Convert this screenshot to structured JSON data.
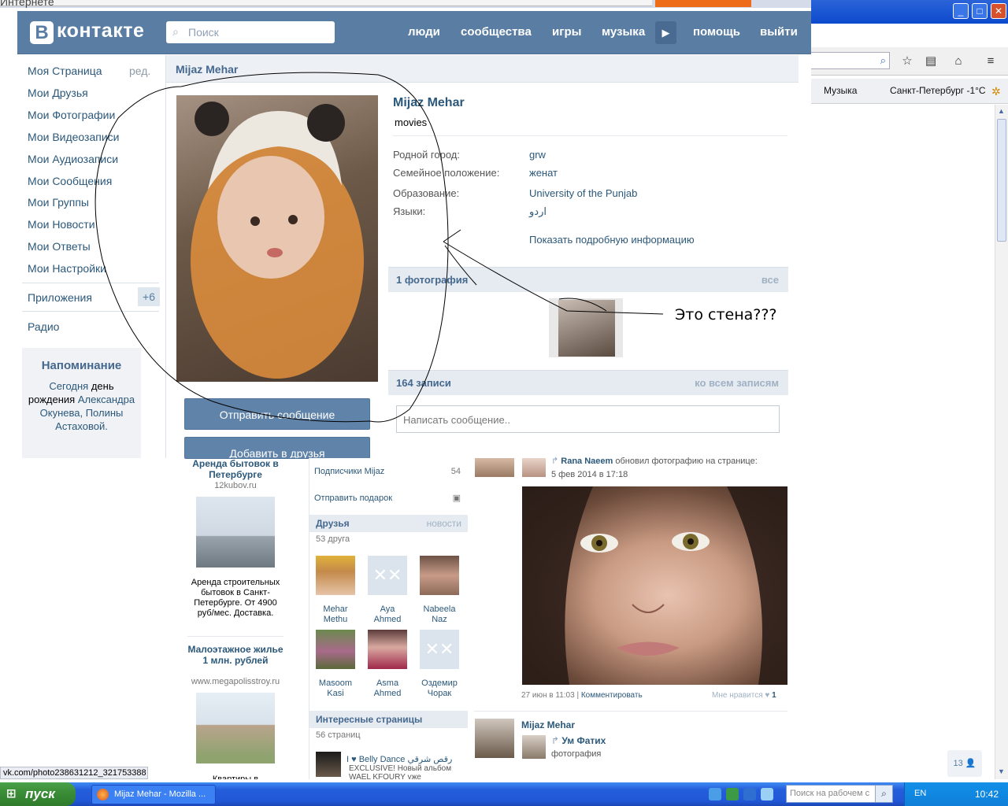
{
  "browser": {
    "title_fragment": "Интернете",
    "win_minimize": "_",
    "win_maximize": "□",
    "win_close": "✕",
    "bookmarks": [
      "Музыка",
      "Санкт-Петербург -1°C"
    ],
    "status_url": "vk.com/photo238631212_321753388"
  },
  "header": {
    "logo_letter": "В",
    "logo_text": "контакте",
    "search_placeholder": "Поиск",
    "nav": [
      "люди",
      "сообщества",
      "игры",
      "музыка",
      "помощь",
      "выйти"
    ]
  },
  "left_menu": {
    "edit": "ред.",
    "items": [
      "Моя Страница",
      "Мои Друзья",
      "Мои Фотографии",
      "Мои Видеозаписи",
      "Мои Аудиозаписи",
      "Мои Сообщения",
      "Мои Группы",
      "Мои Новости",
      "Мои Ответы",
      "Мои Настройки"
    ],
    "apps": "Приложения",
    "apps_badge": "+6",
    "radio": "Радио"
  },
  "reminder": {
    "title": "Напоминание",
    "line1": "Сегодня",
    "line2": "день рождения",
    "names": "Александра Окунева, Полины Астаховой."
  },
  "profile": {
    "name_bar": "Mijaz Mehar",
    "name": "Mijaz Mehar",
    "status": "movies",
    "fields": [
      {
        "label": "Родной город:",
        "value": "grw"
      },
      {
        "label": "Семейное положение:",
        "value": "женат"
      },
      {
        "label": "Образование:",
        "value": "University of the Punjab"
      },
      {
        "label": "Языки:",
        "value": "اردو"
      }
    ],
    "show_more": "Показать подробную информацию",
    "send_message": "Отправить сообщение",
    "add_friend": "Добавить в друзья",
    "photos_title": "1 фотография",
    "photos_all": "все",
    "wall_title": "164 записи",
    "wall_all": "ко всем записям",
    "wall_placeholder": "Написать сообщение.."
  },
  "annotation": "Это стена???",
  "ads": [
    {
      "title": "Аренда бытовок в Петербурге",
      "url": "12kubov.ru",
      "text": "Аренда строительных бытовок в Санкт-Петербурге. От 4900 руб/мес. Доставка."
    },
    {
      "title": "Малоэтажное жилье 1 млн. рублей",
      "url": "www.megapolisstroy.ru",
      "text": "Квартиры в"
    }
  ],
  "mid": {
    "subscribers": "Подписчики Mijaz",
    "subscribers_count": "54",
    "gift": "Отправить подарок",
    "friends_title": "Друзья",
    "friends_news": "новости",
    "friends_count": "53 друга",
    "friends": [
      {
        "first": "Mehar",
        "last": "Methu"
      },
      {
        "first": "Aya",
        "last": "Ahmed"
      },
      {
        "first": "Nabeela",
        "last": "Naz"
      },
      {
        "first": "Masoom",
        "last": "Kasi"
      },
      {
        "first": "Asma",
        "last": "Ahmed"
      },
      {
        "first": "Оздемир",
        "last": "Чорак"
      }
    ],
    "pages_title": "Интересные страницы",
    "pages_count": "56 страниц",
    "page1_title": "I ♥ Belly Dance رقص شرقي",
    "page1_desc": "EXCLUSIVE! Новый альбом WAEL KFOURY уже"
  },
  "wall": {
    "post1_author": "Rana Naeem",
    "post1_action": "обновил фотографию на странице:",
    "post1_date": "5 фев 2014 в 17:18",
    "post1_time": "27 июн в 11:03",
    "post1_comment": "Комментировать",
    "post1_like": "Мне нравится",
    "post1_like_count": "1",
    "post2_author": "Mijaz Mehar",
    "post2_share": "Ум Фатих",
    "post2_sub": "фотография",
    "counter": "13"
  },
  "taskbar": {
    "start": "пуск",
    "task": "Mijaz Mehar - Mozilla ...",
    "search_placeholder": "Поиск на рабочем с",
    "lang": "EN",
    "clock": "10:42"
  }
}
